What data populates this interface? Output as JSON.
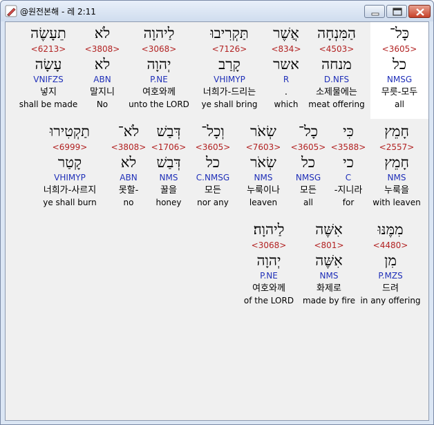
{
  "window": {
    "title": "@원전본해 - 레 2:11"
  },
  "verse": {
    "row1": [
      {
        "heb": "כָּל־",
        "num": "<3605>",
        "root": "כל",
        "gram": "NMSG",
        "kor": "무릇-모두",
        "eng": "all"
      },
      {
        "heb": "הַמִּנְחָה",
        "num": "<4503>",
        "root": "מנחה",
        "gram": "D.NFS",
        "kor": "소제물에는",
        "eng": "meat offering"
      },
      {
        "heb": "אֲשֶׁר",
        "num": "<834>",
        "root": "אשר",
        "gram": "R",
        "kor": ".",
        "eng": "which"
      },
      {
        "heb": "תַּקְרִיבוּ",
        "num": "<7126>",
        "root": "קָרַב",
        "gram": "VHIMYP",
        "kor": "너희가-드리는",
        "eng": "ye shall bring"
      },
      {
        "heb": "לַיהוָה",
        "num": "<3068>",
        "root": "יְהוָה",
        "gram": "P.NE",
        "kor": "여호와께",
        "eng": "unto the LORD"
      },
      {
        "heb": "לֹא",
        "num": "<3808>",
        "root": "לא",
        "gram": "ABN",
        "kor": "말지니",
        "eng": "No"
      },
      {
        "heb": "תֵעָשֶׂה",
        "num": "<6213>",
        "root": "עָשָׂה",
        "gram": "VNIFZS",
        "kor": "넣지",
        "eng": "shall be made"
      }
    ],
    "row2": [
      {
        "heb": "חָמֵץ",
        "num": "<2557>",
        "root": "חָמֵץ",
        "gram": "NMS",
        "kor": "누룩을",
        "eng": "with leaven"
      },
      {
        "heb": "כִּי",
        "num": "<3588>",
        "root": "כי",
        "gram": "C",
        "kor": "-지니라",
        "eng": "for"
      },
      {
        "heb": "כָל־",
        "num": "<3605>",
        "root": "כל",
        "gram": "NMSG",
        "kor": "모든",
        "eng": "all"
      },
      {
        "heb": "שְׂאֹר",
        "num": "<7603>",
        "root": "שְׂאֹר",
        "gram": "NMS",
        "kor": "누룩이나",
        "eng": "leaven"
      },
      {
        "heb": "וְכָל־",
        "num": "<3605>",
        "root": "כל",
        "gram": "C.NMSG",
        "kor": "모든",
        "eng": "nor any"
      },
      {
        "heb": "דְּבַשׁ",
        "num": "<1706>",
        "root": "דְּבַשׁ",
        "gram": "NMS",
        "kor": "꿀을",
        "eng": "honey"
      },
      {
        "heb": "לֹא־",
        "num": "<3808>",
        "root": "לא",
        "gram": "ABN",
        "kor": "못할-",
        "eng": "no"
      },
      {
        "heb": "תַקְטִירוּ",
        "num": "<6999>",
        "root": "קָטַר",
        "gram": "VHIMYP",
        "kor": "너희가-사르지",
        "eng": "ye shall burn"
      }
    ],
    "row3": [
      {
        "heb": "מִמֶּנּוּ",
        "num": "<4480>",
        "root": "מִן",
        "gram": "P.MZS",
        "kor": "드려",
        "eng": "in any offering"
      },
      {
        "heb": "אִשֶּׁה",
        "num": "<801>",
        "root": "אִשֶּׁה",
        "gram": "NMS",
        "kor": "화제로",
        "eng": "made by fire"
      },
      {
        "heb": "לַיהוָה׃",
        "num": "<3068>",
        "root": "יְהוָה",
        "gram": "P.NE",
        "kor": "여호와께",
        "eng": "of the LORD"
      }
    ]
  }
}
